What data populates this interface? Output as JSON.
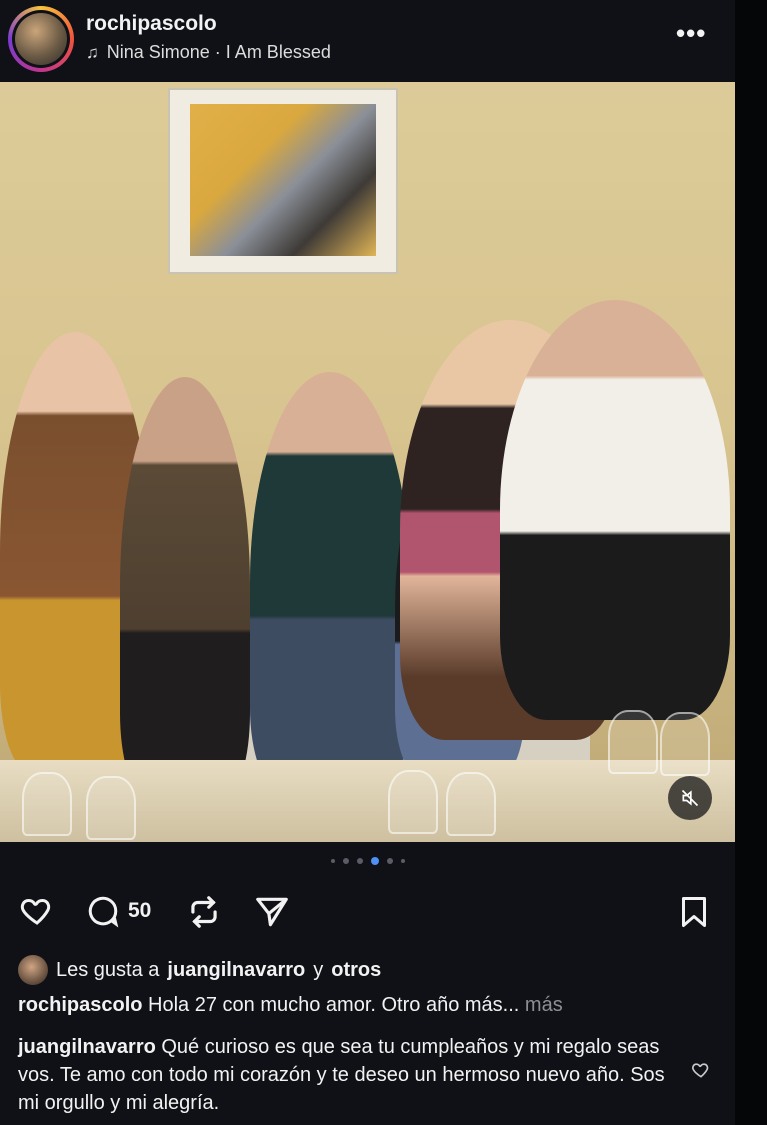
{
  "post": {
    "username": "rochipascolo",
    "music": "Nina Simone · I Am Blessed",
    "comment_count": "50",
    "likes": {
      "prefix": "Les gusta a",
      "user": "juangilnavarro",
      "joiner": "y",
      "others": "otros"
    },
    "caption": {
      "user": "rochipascolo",
      "text": "Hola 27 con mucho amor. Otro año más...",
      "more": "más"
    },
    "comment": {
      "user": "juangilnavarro",
      "text": "Qué curioso es que sea tu cumpleaños y mi regalo seas vos. Te amo con todo mi corazón y  te deseo un hermoso nuevo año. Sos mi orgullo y mi alegría."
    }
  },
  "carousel": {
    "total": 7,
    "active_index": 3
  },
  "icons": {
    "music": "music-note-icon",
    "more": "more-options-icon",
    "like": "heart-icon",
    "comment": "comment-icon",
    "repost": "repost-icon",
    "share": "send-icon",
    "save": "bookmark-icon",
    "mute": "speaker-muted-icon"
  },
  "colors": {
    "background": "#0f1116",
    "text": "#f2f2f2",
    "muted_text": "#8d8f96",
    "active_dot": "#4f8ff7"
  }
}
